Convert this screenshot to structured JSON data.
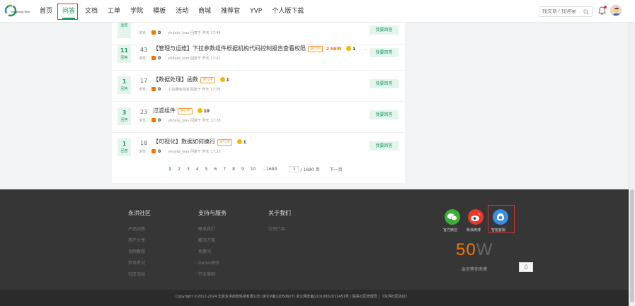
{
  "header": {
    "logo_text": "Yonghong Tech",
    "nav": [
      "首页",
      "问答",
      "文档",
      "工单",
      "学院",
      "模板",
      "活动",
      "商城",
      "推荐官",
      "YVP",
      "个人版下载"
    ],
    "active_nav": "问答",
    "search_placeholder": "找文章 / 找答案"
  },
  "questions": [
    {
      "answers": "",
      "answer_label": "回答",
      "views": "",
      "view_label": "浏览",
      "title": "",
      "tags": [],
      "new": "",
      "reward": "",
      "likes": "0",
      "meta": "yhdata_lyaa 回复于 昨天 17:48",
      "more": false
    },
    {
      "answers": "11",
      "answer_label": "回答",
      "views": "43",
      "view_label": "浏览",
      "title": "【管理与运维】下拉参数组件根据机构代码控制报告查看权限",
      "tag": "进行中",
      "new_prefix": "2",
      "new": "NEW",
      "reward": "1",
      "likes": "0",
      "meta": "yhdata_yzm 回复于 昨天 17:41",
      "more": true
    },
    {
      "answers": "1",
      "answer_label": "回答",
      "views": "17",
      "view_label": "浏览",
      "title": "【数据处理】函数",
      "tag": "进行中",
      "new_prefix": "",
      "new": "",
      "reward": "1",
      "likes": "0",
      "meta": "小白爆哈加油 回复于 昨天 17:29",
      "more": false
    },
    {
      "answers": "3",
      "answer_label": "回答",
      "views": "23",
      "view_label": "浏览",
      "title": "过滤组件",
      "tag": "进行中",
      "new_prefix": "",
      "new": "",
      "reward": "10",
      "likes": "0",
      "meta": "yhdata_lyaa 回复于 昨天 17:28",
      "more": false
    },
    {
      "answers": "1",
      "answer_label": "回答",
      "views": "18",
      "view_label": "浏览",
      "title": "【可视化】数据如何换行",
      "tag": "进行中",
      "new_prefix": "",
      "new": "",
      "reward": "1",
      "likes": "0",
      "meta": "yhdata_lyaa 回复于 昨天 17:23",
      "more": false
    }
  ],
  "answer_button": "我要回答",
  "more_label": "...",
  "pagination": {
    "pages": [
      "1",
      "2",
      "3",
      "4",
      "5",
      "6",
      "7",
      "8",
      "9",
      "10",
      "...1690"
    ],
    "current": "1",
    "input_value": "1",
    "total": "/ 1690 页",
    "next": "下一页"
  },
  "footer": {
    "columns": [
      {
        "heading": "永洪社区",
        "links": [
          "产品问答",
          "用户分享",
          "视频教程",
          "参培考试",
          "社区活动"
        ]
      },
      {
        "heading": "支持与服务",
        "links": [
          "联系我们",
          "解决方案",
          "免费问",
          "Demo体验",
          "行业案例"
        ]
      },
      {
        "heading": "关于我们",
        "links": [
          "公司介绍"
        ]
      }
    ],
    "social": [
      {
        "label": "官方微信",
        "icon": "wechat-icon",
        "color": "#3cb035"
      },
      {
        "label": "新浪微博",
        "icon": "weibo-icon",
        "color": "#e6372d"
      },
      {
        "label": "智能客服",
        "icon": "service-icon",
        "color": "#3a8de0"
      }
    ],
    "big_number": "50",
    "big_unit": "W",
    "big_caption": "会员等你来撩",
    "copyright": "Copyright ©2012-2024 北京永洪商智科技有限公司 (京ICP备12050607) 京公网安备11010802011451号 | 联系社区管理员 | 《永洪社区协议》"
  }
}
